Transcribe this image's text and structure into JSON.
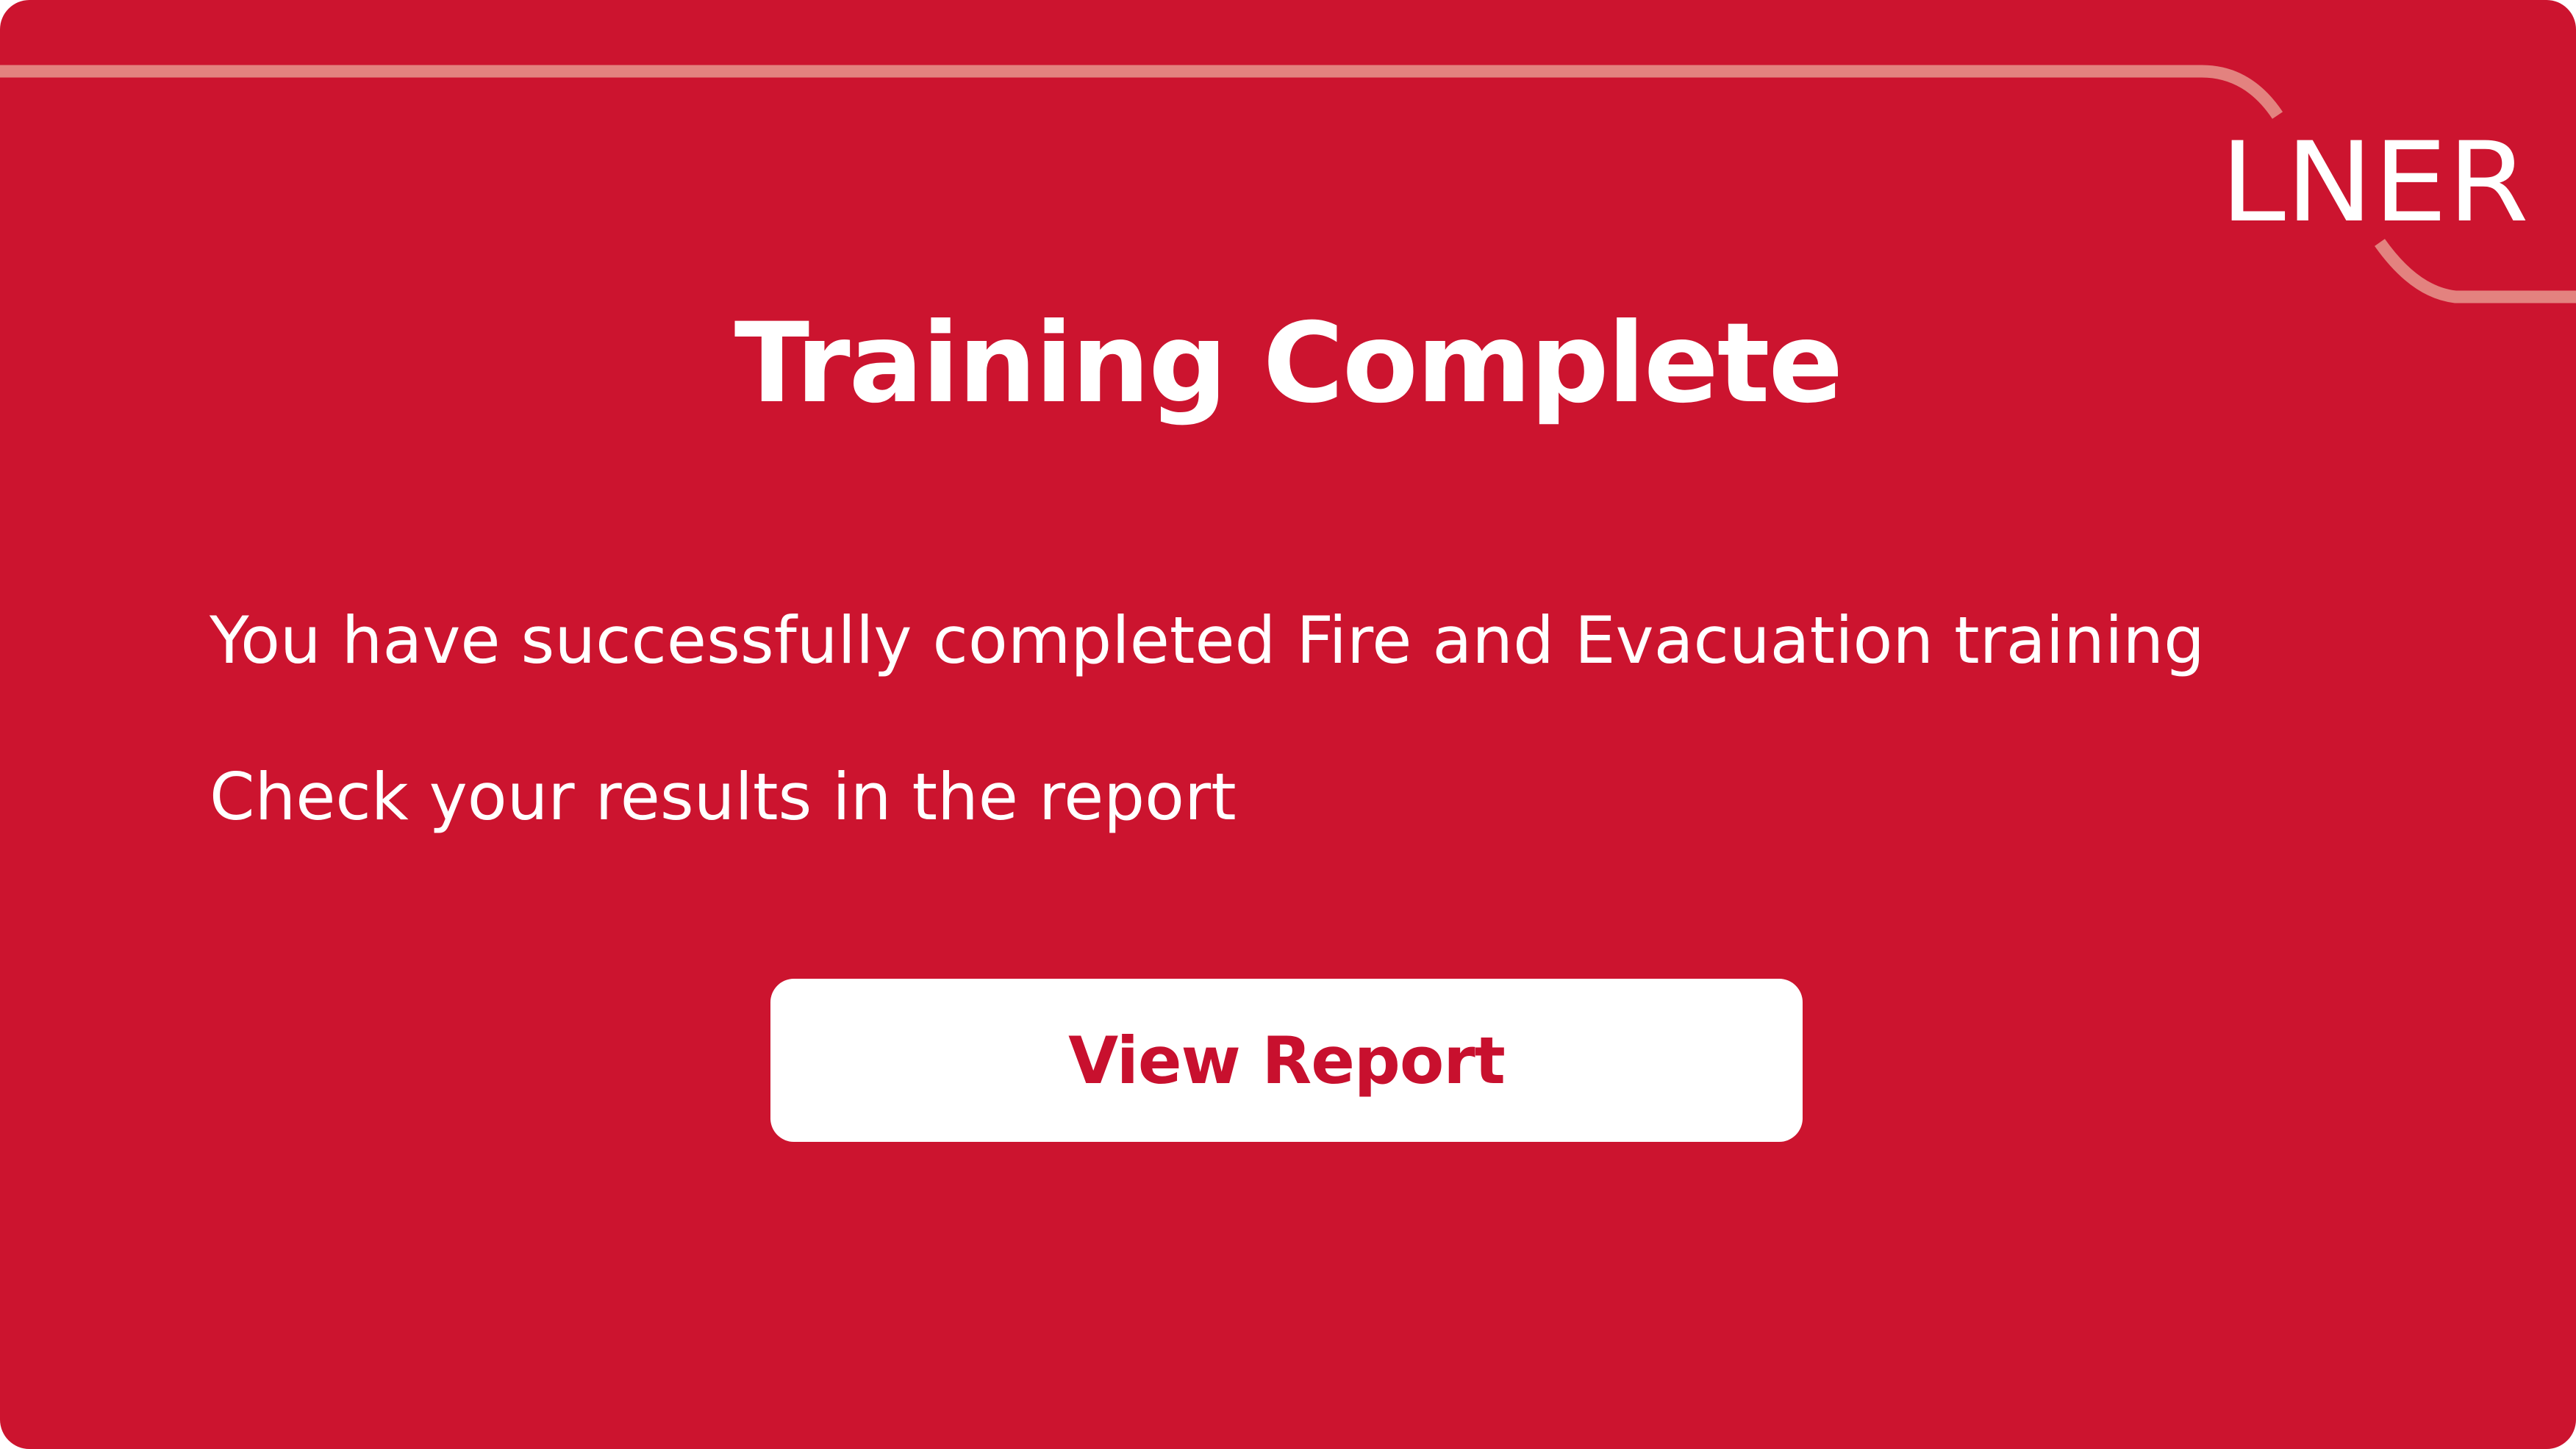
{
  "colors": {
    "background": "#cc142f",
    "accent_line": "#e3827f",
    "text": "#ffffff",
    "button_bg": "#ffffff",
    "button_text": "#c8102e"
  },
  "logo": {
    "text": "LNER"
  },
  "dialog": {
    "title": "Training Complete",
    "message": "You have successfully completed Fire and Evacuation training",
    "instruction": "Check your results in the report",
    "button_label": "View Report"
  }
}
